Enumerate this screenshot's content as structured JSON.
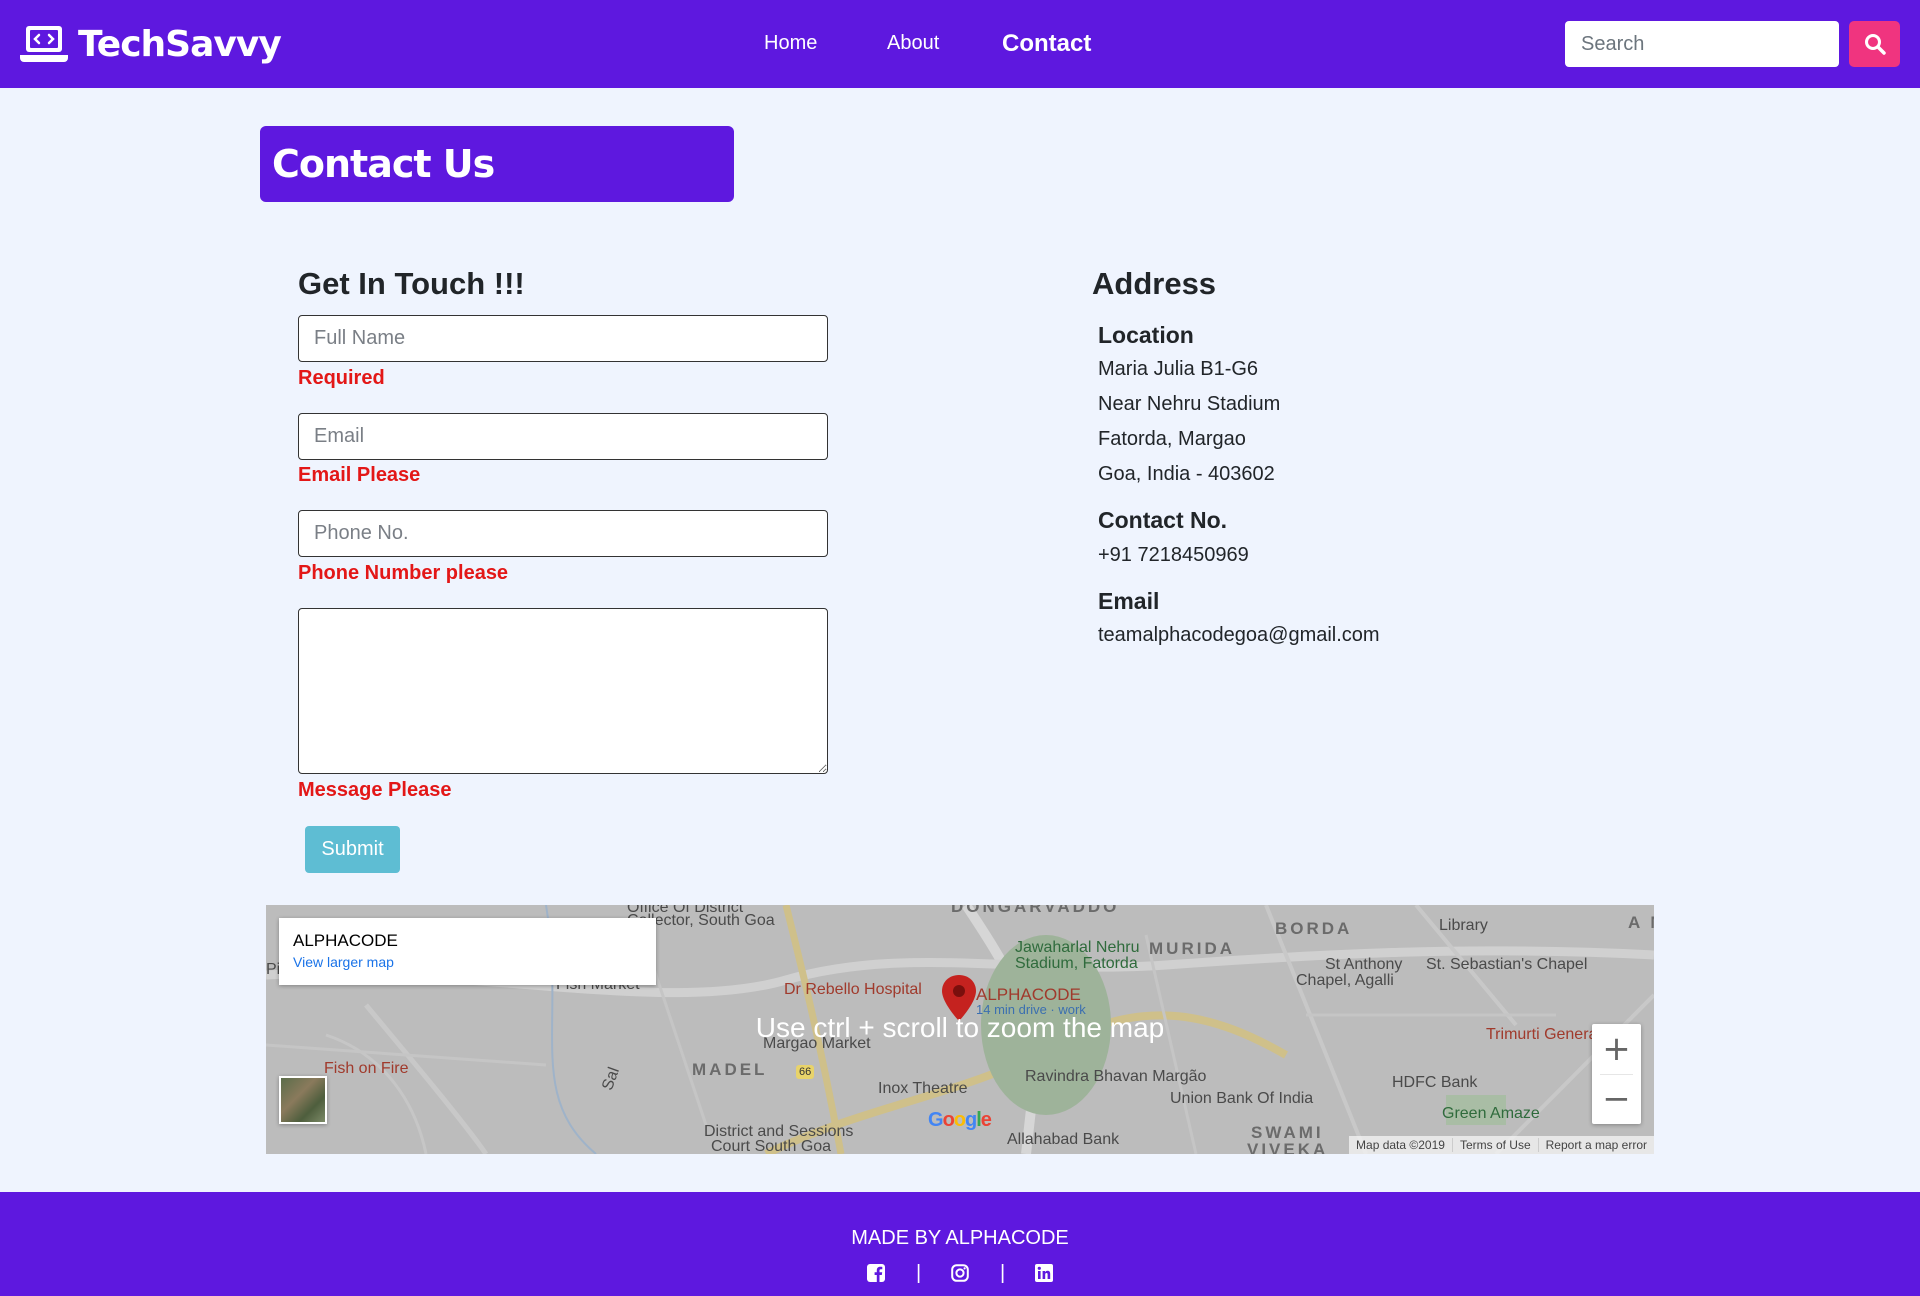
{
  "brand": {
    "name": "TechSavvy"
  },
  "nav": {
    "items": [
      "Home",
      "About",
      "Contact"
    ],
    "active": "Contact"
  },
  "search": {
    "placeholder": "Search"
  },
  "page_title": "Contact Us",
  "form": {
    "heading": "Get In Touch !!!",
    "full_name": {
      "placeholder": "Full Name",
      "value": "",
      "error": "Required"
    },
    "email": {
      "placeholder": "Email",
      "value": "",
      "error": "Email Please"
    },
    "phone": {
      "placeholder": "Phone No.",
      "value": "",
      "error": "Phone Number please"
    },
    "message": {
      "value": "",
      "error": "Message Please"
    },
    "submit_label": "Submit"
  },
  "address": {
    "heading": "Address",
    "location_label": "Location",
    "location_lines": [
      "Maria Julia B1-G6",
      "Near Nehru Stadium",
      "Fatorda, Margao",
      "Goa, India - 403602"
    ],
    "contact_label": "Contact No.",
    "contact_value": "+91 7218450969",
    "email_label": "Email",
    "email_value": "teamalphacodegoa@gmail.com"
  },
  "map": {
    "place_name": "ALPHACODE",
    "view_larger": "View larger map",
    "overlay_hint": "Use ctrl + scroll to zoom the map",
    "pin_label": "ALPHACODE",
    "pin_sublabel": "14 min drive · work",
    "labels": {
      "office": "Office Of District",
      "collector": "Collector, South Goa",
      "dongarvaddo": "DONGARVADDO",
      "jnstadium1": "Jawaharlal Nehru",
      "jnstadium2": "Stadium, Fatorda",
      "murida": "MURIDA",
      "borda": "BORDA",
      "library": "Library",
      "st_anthony1": "St Anthony",
      "st_anthony2": "Chapel, Agalli",
      "st_sebastian": "St. Sebastian's Chapel",
      "fish_market": "Fish Market",
      "rebello": "Dr Rebello Hospital",
      "margao_market": "Margao Market",
      "trimurti": "Trimurti General Ho",
      "fish_on_fire": "Fish on Fire",
      "madel": "MADEL",
      "inox": "Inox Theatre",
      "ravindra": "Ravindra Bhavan Margão",
      "hdfc": "HDFC Bank",
      "union": "Union Bank Of India",
      "green_amaze": "Green Amaze",
      "court1": "District and Sessions",
      "court2": "Court South Goa",
      "allahabad": "Allahabad Bank",
      "swami1": "SWAMI",
      "swami2": "VIVEKA",
      "sal": "Sal",
      "pil": "Pil",
      "am": "A M",
      "road66": "66"
    },
    "zoom_in": "+",
    "zoom_out": "−",
    "google": [
      "G",
      "o",
      "o",
      "g",
      "l",
      "e"
    ],
    "footer": [
      "Map data ©2019",
      "Terms of Use",
      "Report a map error"
    ]
  },
  "footer": {
    "made_by": "MADE BY ALPHACODE",
    "separator": "|",
    "socials": [
      "facebook-icon",
      "instagram-icon",
      "linkedin-icon"
    ]
  },
  "colors": {
    "brand": "#5e18df",
    "accent_pink": "#f0347f",
    "error_red": "#e31717",
    "submit": "#5ebdd3",
    "background": "#eff4fe"
  }
}
